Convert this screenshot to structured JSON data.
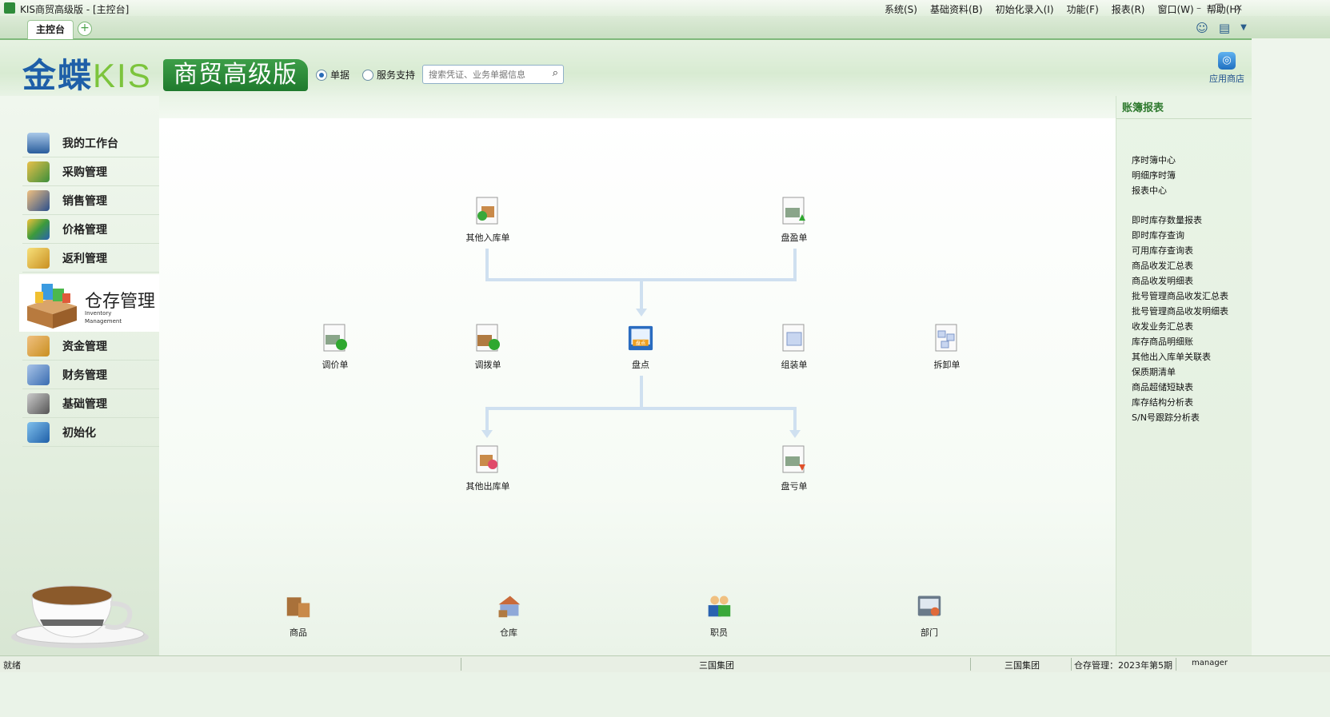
{
  "window": {
    "title": "KIS商贸高级版 - [主控台]"
  },
  "menu": [
    "系统(S)",
    "基础资料(B)",
    "初始化录入(I)",
    "功能(F)",
    "报表(R)",
    "窗口(W)",
    "帮助(H)"
  ],
  "tabs": {
    "active": "主控台",
    "add_symbol": "+"
  },
  "logo": {
    "brand": "金蝶",
    "kis": "KIS",
    "edition": "商贸高级版"
  },
  "search": {
    "options": [
      "单据",
      "服务支持"
    ],
    "selected": "单据",
    "placeholder": "搜索凭证、业务单据信息"
  },
  "appstore": {
    "label": "应用商店"
  },
  "sidebar": {
    "items": [
      {
        "label": "我的工作台",
        "icon": "monitor-icon"
      },
      {
        "label": "采购管理",
        "icon": "purchase-icon"
      },
      {
        "label": "销售管理",
        "icon": "sales-icon"
      },
      {
        "label": "价格管理",
        "icon": "price-icon"
      },
      {
        "label": "返利管理",
        "icon": "rebate-icon"
      }
    ],
    "active": {
      "label": "仓存管理",
      "sub1": "Inventory",
      "sub2": "Management",
      "icon": "inventory-icon"
    },
    "items_after": [
      {
        "label": "资金管理",
        "icon": "funds-icon"
      },
      {
        "label": "财务管理",
        "icon": "finance-icon"
      },
      {
        "label": "基础管理",
        "icon": "basic-icon"
      },
      {
        "label": "初始化",
        "icon": "init-icon"
      }
    ]
  },
  "flow": {
    "nodes": {
      "other_in": "其他入库单",
      "surplus": "盘盈单",
      "price_adj": "调价单",
      "transfer": "调拨单",
      "stocktake": "盘点",
      "stocktake_badge": "盘点",
      "assembly": "组装单",
      "disassembly": "拆卸单",
      "other_out": "其他出库单",
      "loss": "盘亏单"
    },
    "base": {
      "goods": "商品",
      "warehouse": "仓库",
      "staff": "职员",
      "department": "部门"
    }
  },
  "reports": {
    "title": "账簿报表",
    "group1": [
      "序时簿中心",
      "明细序时簿",
      "报表中心"
    ],
    "group2": [
      "即时库存数量报表",
      "即时库存查询",
      "可用库存查询表",
      "商品收发汇总表",
      "商品收发明细表",
      "批号管理商品收发汇总表",
      "批号管理商品收发明细表",
      "收发业务汇总表",
      "库存商品明细账",
      "其他出入库单关联表",
      "保质期清单",
      "商品超储短缺表",
      "库存结构分析表",
      "S/N号跟踪分析表"
    ]
  },
  "status": {
    "ready": "就绪",
    "company_center": "三国集团",
    "company_right": "三国集团",
    "period": "仓存管理：2023年第5期",
    "user": "manager"
  },
  "colors": {
    "accent": "#2e8b3a",
    "brand_blue": "#1e5fa8",
    "kis_green": "#7cc43c"
  }
}
